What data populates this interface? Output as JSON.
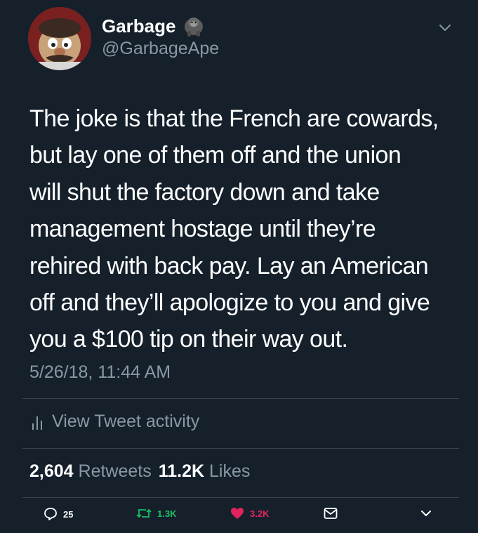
{
  "header": {
    "display_name": "Garbage",
    "handle": "@GarbageApe"
  },
  "tweet": {
    "lines": [
      "The joke is that the French are cowards,",
      "but lay one of them off and the union",
      "will shut the factory down and take",
      "management hostage until they’re",
      "rehired with back pay. Lay an American",
      "off and they’ll apologize to you and give",
      "you a $100 tip on their way out."
    ],
    "timestamp": "5/26/18, 11:44 AM"
  },
  "activity": {
    "label": "View Tweet activity"
  },
  "stats": {
    "retweets_count": "2,604",
    "retweets_label": "Retweets",
    "likes_count": "11.2K",
    "likes_label": "Likes"
  },
  "actions": {
    "replies": "25",
    "retweets": "1.3K",
    "likes": "3.2K"
  },
  "colors": {
    "background": "#15202b",
    "secondary_text": "#8899a6",
    "divider": "#38444d",
    "retweet_green": "#17bf63",
    "like_pink": "#e0245e"
  },
  "icons": [
    "ape-emoji-icon",
    "chevron-down-icon",
    "bar-chart-icon",
    "reply-icon",
    "retweet-icon",
    "heart-icon",
    "mail-icon"
  ]
}
